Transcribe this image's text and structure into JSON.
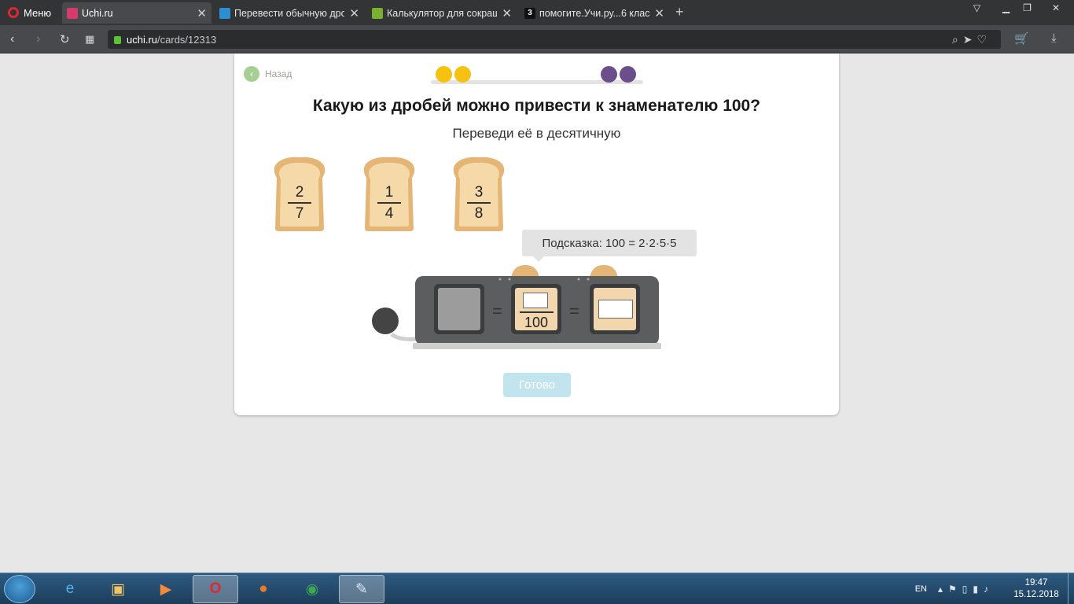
{
  "browser": {
    "menu_label": "Меню",
    "tabs": [
      {
        "title": "Uchi.ru",
        "fav_color": "#d63a6c",
        "active": true
      },
      {
        "title": "Перевести обычную дро",
        "fav_color": "#2a8fd3",
        "active": false
      },
      {
        "title": "Калькулятор для сокращ",
        "fav_color": "#7ab030",
        "active": false
      },
      {
        "title": "помогите.Учи.ру...6 класс",
        "fav_color": "#111111",
        "active": false
      }
    ],
    "url_host": "uchi.ru",
    "url_path": "/cards/12313"
  },
  "card": {
    "back_label": "Назад",
    "title": "Какую из дробей можно привести к знаменателю 100?",
    "subtitle": "Переведи её в десятичную",
    "progress_dots": [
      {
        "color": "#f6c20f"
      },
      {
        "color": "#f6c20f"
      },
      {
        "color": "#6d4e8c"
      },
      {
        "color": "#6d4e8c"
      }
    ],
    "fractions": [
      {
        "numerator": "2",
        "denominator": "7"
      },
      {
        "numerator": "1",
        "denominator": "4"
      },
      {
        "numerator": "3",
        "denominator": "8"
      }
    ],
    "hint": "Подсказка: 100 = 2·2·5·5",
    "toaster": {
      "equals": "=",
      "denominator": "100"
    },
    "ready_label": "Готово",
    "ready_color": "#c2e4ef"
  },
  "taskbar": {
    "lang": "EN",
    "time": "19:47",
    "date": "15.12.2018"
  }
}
